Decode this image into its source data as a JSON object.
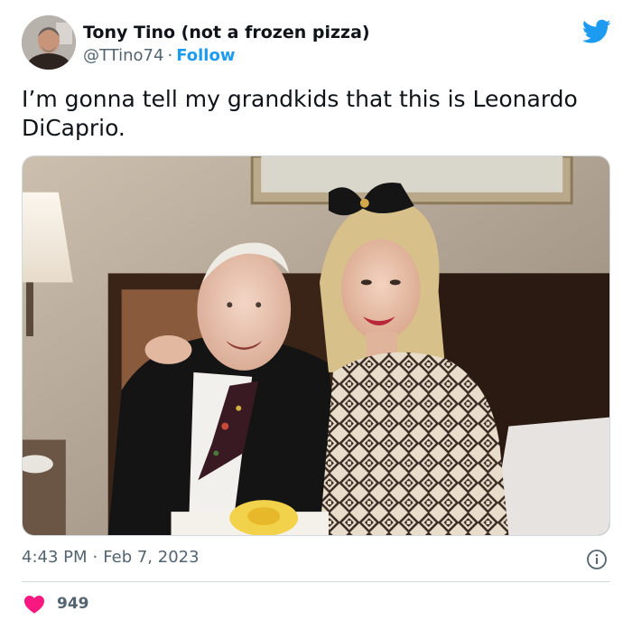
{
  "author": {
    "display_name": "Tony Tino (not a frozen pizza)",
    "handle": "@TTino74",
    "separator": "·",
    "follow_label": "Follow"
  },
  "tweet": {
    "text": "I’m gonna tell my grandkids that this is Leonardo DiCaprio.",
    "time": "4:43 PM",
    "separator": "·",
    "date": "Feb 7, 2023",
    "likes": "949"
  },
  "icons": {
    "brand": "twitter-bird-icon",
    "info": "info-icon",
    "like": "heart-icon"
  },
  "colors": {
    "brand_blue": "#1d9bf0",
    "heart_pink": "#f91880",
    "text_primary": "#0f1419",
    "text_secondary": "#536471"
  }
}
